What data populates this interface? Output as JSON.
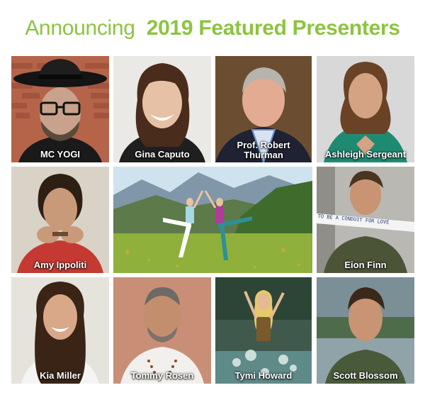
{
  "header": {
    "announcing": "Announcing",
    "title": "2019 Featured Presenters"
  },
  "presenters": [
    {
      "name": "MC YOGI"
    },
    {
      "name": "Gina Caputo"
    },
    {
      "name_line1": "Prof. Robert",
      "name_line2": "Thurman"
    },
    {
      "name": "Ashleigh Sergeant"
    },
    {
      "name": "Amy Ippoliti"
    },
    {
      "name": "Eion Finn"
    },
    {
      "name": "Kia Miller"
    },
    {
      "name": "Tommy Rosen"
    },
    {
      "name": "Tymi Howard"
    },
    {
      "name": "Scott Blossom"
    }
  ],
  "photo_text": {
    "banner": "TO BE A CONDUIT FOR LOVE"
  },
  "colors": {
    "accent_green": "#8cc43f",
    "caption_text": "#ffffff"
  }
}
